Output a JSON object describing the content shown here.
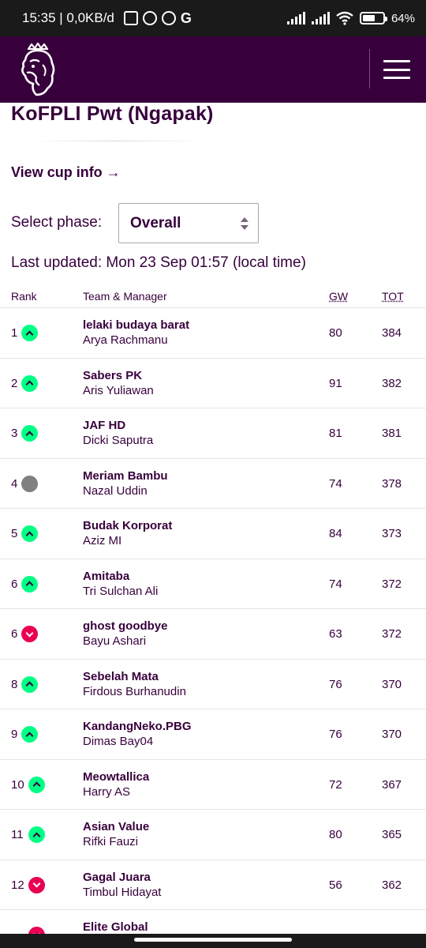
{
  "status_bar": {
    "time_net": "15:35 | 0,0KB/d",
    "g_label": "G",
    "battery_text": "64%",
    "battery_level": 0.64
  },
  "header": {
    "logo_icon": "premier-league-lion-icon",
    "menu_icon": "hamburger-menu-icon"
  },
  "league": {
    "title": "KoFPLI Pwt (Ngapak)",
    "cup_link": "View cup info →",
    "phase_label": "Select phase:",
    "phase_value": "Overall",
    "last_updated": "Last updated: Mon 23 Sep 01:57 (local time)"
  },
  "table": {
    "headers": {
      "rank": "Rank",
      "team": "Team & Manager",
      "gw": "GW",
      "tot": "TOT"
    },
    "rows": [
      {
        "rank": "1",
        "movement": "up",
        "team": "lelaki budaya barat",
        "manager": "Arya Rachmanu",
        "gw": "80",
        "tot": "384"
      },
      {
        "rank": "2",
        "movement": "up",
        "team": "Sabers PK",
        "manager": "Aris Yuliawan",
        "gw": "91",
        "tot": "382"
      },
      {
        "rank": "3",
        "movement": "up",
        "team": "JAF HD",
        "manager": "Dicki Saputra",
        "gw": "81",
        "tot": "381"
      },
      {
        "rank": "4",
        "movement": "same",
        "team": "Meriam Bambu",
        "manager": "Nazal Uddin",
        "gw": "74",
        "tot": "378"
      },
      {
        "rank": "5",
        "movement": "up",
        "team": "Budak Korporat",
        "manager": "Aziz MI",
        "gw": "84",
        "tot": "373"
      },
      {
        "rank": "6",
        "movement": "up",
        "team": "Amitaba",
        "manager": "Tri Sulchan Ali",
        "gw": "74",
        "tot": "372"
      },
      {
        "rank": "6",
        "movement": "down",
        "team": "ghost goodbye",
        "manager": "Bayu Ashari",
        "gw": "63",
        "tot": "372"
      },
      {
        "rank": "8",
        "movement": "up",
        "team": "Sebelah Mata",
        "manager": "Firdous Burhanudin",
        "gw": "76",
        "tot": "370"
      },
      {
        "rank": "9",
        "movement": "up",
        "team": "KandangNeko.PBG",
        "manager": "Dimas Bay04",
        "gw": "76",
        "tot": "370"
      },
      {
        "rank": "10",
        "movement": "up",
        "team": "Meowtallica",
        "manager": "Harry AS",
        "gw": "72",
        "tot": "367"
      },
      {
        "rank": "11",
        "movement": "up",
        "team": "Asian Value",
        "manager": "Rifki Fauzi",
        "gw": "80",
        "tot": "365"
      },
      {
        "rank": "12",
        "movement": "down",
        "team": "Gagal Juara",
        "manager": "Timbul Hidayat",
        "gw": "56",
        "tot": "362"
      },
      {
        "rank": "",
        "movement": "down",
        "team": "Elite Global",
        "manager": "",
        "gw": "",
        "tot": ""
      }
    ]
  },
  "colors": {
    "brand_purple": "#37003c",
    "up_green": "#00ff85",
    "down_pink": "#e90052",
    "same_grey": "#808080"
  }
}
